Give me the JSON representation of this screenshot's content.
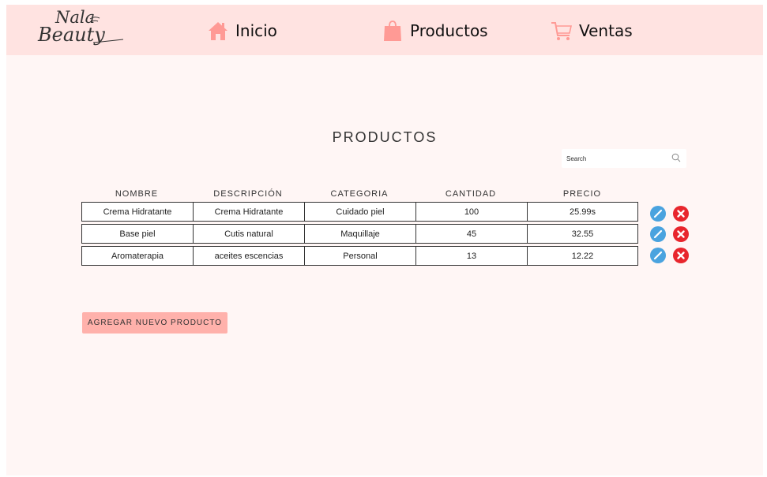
{
  "brand": {
    "line1": "Nala",
    "line2": "Beauty"
  },
  "nav": {
    "items": [
      {
        "label": "Inicio",
        "icon": "home-icon"
      },
      {
        "label": "Productos",
        "icon": "shopping-bag-icon"
      },
      {
        "label": "Ventas",
        "icon": "shopping-cart-icon"
      }
    ]
  },
  "page": {
    "title": "PRODUCTOS"
  },
  "search": {
    "placeholder": "Search"
  },
  "table": {
    "headers": [
      "NOMBRE",
      "DESCRIPCIÓN",
      "CATEGORIA",
      "CANTIDAD",
      "PRECIO"
    ],
    "rows": [
      {
        "nombre": "Crema Hidratante",
        "descripcion": "Crema Hidratante",
        "categoria": "Cuidado piel",
        "cantidad": "100",
        "precio": "25.99s"
      },
      {
        "nombre": "Base piel",
        "descripcion": "Cutis natural",
        "categoria": "Maquillaje",
        "cantidad": "45",
        "precio": "32.55"
      },
      {
        "nombre": "Aromaterapia",
        "descripcion": "aceites escencias",
        "categoria": "Personal",
        "cantidad": "13",
        "precio": "12.22"
      }
    ]
  },
  "actions": {
    "add_label": "AGREGAR NUEVO PRODUCTO"
  },
  "colors": {
    "navbar": "#ffe3e1",
    "background": "#fff6f5",
    "accent_icon": "#ff9a95",
    "add_button": "#ffb1ab",
    "edit": "#4aa3df",
    "delete": "#e8262d"
  }
}
